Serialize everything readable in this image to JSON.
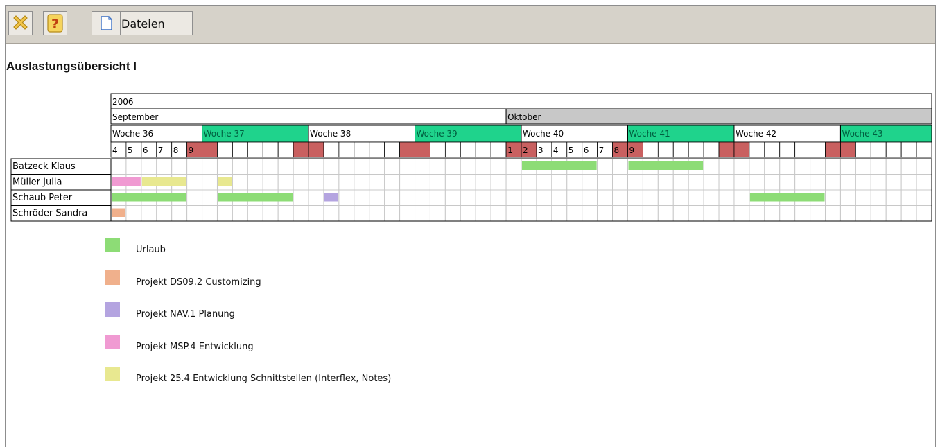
{
  "toolbar": {
    "close_icon": "close-icon",
    "help_icon": "help-icon",
    "files_icon": "document-icon",
    "files_label": "Dateien"
  },
  "page": {
    "title": "Auslastungsübersicht I"
  },
  "calendar": {
    "year": "2006",
    "months": [
      {
        "label": "September",
        "days": 26,
        "color": "#ffffff"
      },
      {
        "label": "Oktober",
        "days": 28,
        "color": "#c8c8c8"
      }
    ],
    "weeks": [
      {
        "label": "Woche 36",
        "days": 6,
        "color": "#ffffff",
        "text_color": "#000000"
      },
      {
        "label": "Woche 37",
        "days": 7,
        "color": "#1fd38c",
        "text_color": "#006040"
      },
      {
        "label": "Woche 38",
        "days": 7,
        "color": "#ffffff",
        "text_color": "#000000"
      },
      {
        "label": "Woche 39",
        "days": 7,
        "color": "#1fd38c",
        "text_color": "#006040"
      },
      {
        "label": "Woche 40",
        "days": 7,
        "color": "#ffffff",
        "text_color": "#000000"
      },
      {
        "label": "Woche 41",
        "days": 7,
        "color": "#1fd38c",
        "text_color": "#006040"
      },
      {
        "label": "Woche 42",
        "days": 7,
        "color": "#ffffff",
        "text_color": "#000000"
      },
      {
        "label": "Woche 43",
        "days": 6,
        "color": "#1fd38c",
        "text_color": "#006040"
      }
    ],
    "day_labels": [
      "4",
      "5",
      "6",
      "7",
      "8",
      "9",
      "",
      "",
      "",
      "",
      "",
      "",
      "",
      "",
      "",
      "",
      "",
      "",
      "",
      "",
      "",
      "",
      "",
      "",
      "",
      "",
      "1",
      "2",
      "3",
      "4",
      "5",
      "6",
      "7",
      "8",
      "9",
      "",
      "",
      "",
      "",
      "",
      "",
      "",
      "",
      "",
      "",
      "",
      "",
      "",
      "",
      "",
      "",
      "",
      "",
      ""
    ],
    "weekend_days": [
      5,
      6,
      12,
      13,
      19,
      20,
      26,
      27,
      33,
      34,
      40,
      41,
      47,
      48,
      54
    ],
    "weekend_color": "#c96060"
  },
  "people": [
    {
      "name": "Batzeck Klaus",
      "bars": [
        {
          "start": 27,
          "end": 31,
          "color": "#8ddc76"
        },
        {
          "start": 34,
          "end": 38,
          "color": "#8ddc76"
        }
      ]
    },
    {
      "name": "Müller Julia",
      "bars": [
        {
          "start": 0,
          "end": 1,
          "color": "#f09ad2"
        },
        {
          "start": 2,
          "end": 4,
          "color": "#e8e890"
        },
        {
          "start": 7,
          "end": 7,
          "color": "#e8e890"
        }
      ]
    },
    {
      "name": "Schaub Peter",
      "bars": [
        {
          "start": 0,
          "end": 4,
          "color": "#8ddc76"
        },
        {
          "start": 7,
          "end": 11,
          "color": "#8ddc76"
        },
        {
          "start": 14,
          "end": 14,
          "color": "#b4a4e0"
        },
        {
          "start": 42,
          "end": 46,
          "color": "#8ddc76"
        }
      ]
    },
    {
      "name": "Schröder Sandra",
      "bars": [
        {
          "start": 0,
          "end": 0,
          "color": "#f0b08c"
        }
      ]
    }
  ],
  "legend": [
    {
      "label": "Urlaub",
      "color": "#8ddc76"
    },
    {
      "label": "Projekt DS09.2 Customizing",
      "color": "#f0b08c"
    },
    {
      "label": "Projekt NAV.1 Planung",
      "color": "#b4a4e0"
    },
    {
      "label": "Projekt MSP.4 Entwicklung",
      "color": "#f09ad2"
    },
    {
      "label": "Projekt 25.4 Entwicklung Schnittstellen (Interflex, Notes)",
      "color": "#e8e890"
    }
  ]
}
